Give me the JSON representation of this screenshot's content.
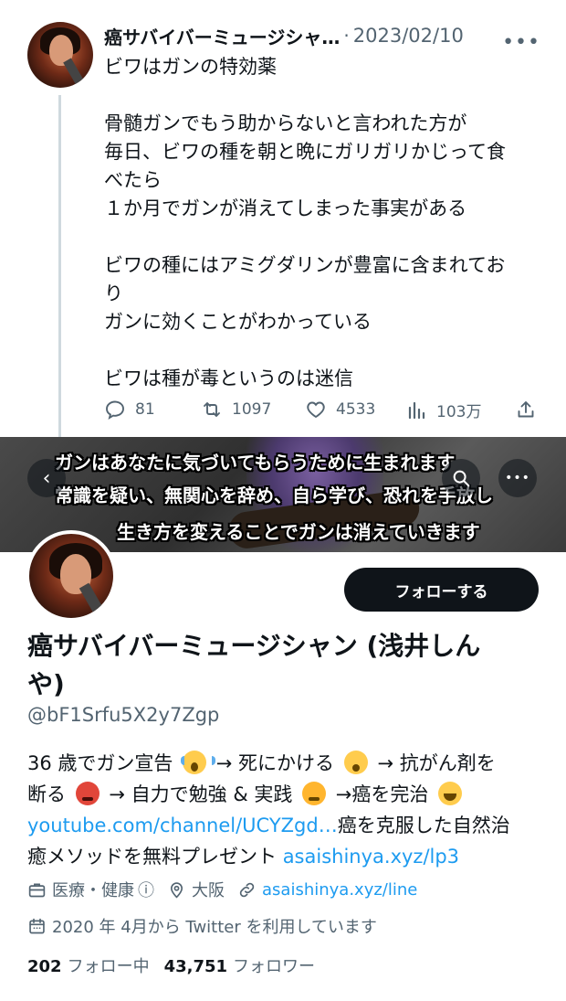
{
  "tweet": {
    "author_name": "癌サバイバーミュージシャ…",
    "separator": "·",
    "date": "2023/02/10",
    "more": "•••",
    "paragraphs": [
      [
        "ビワはガンの特効薬"
      ],
      [
        "骨髄ガンでもう助からないと言われた方が",
        "毎日、ビワの種を朝と晩にガリガリかじって食",
        "べたら",
        "１か月でガンが消えてしまった事実がある"
      ],
      [
        "ビワの種にはアミグダリンが豊富に含まれてお",
        "り",
        "ガンに効くことがわかっている"
      ],
      [
        "ビワは種が毒というのは迷信"
      ]
    ],
    "actions": {
      "replies": "81",
      "retweets": "1097",
      "likes": "4533",
      "views": "103万"
    }
  },
  "banner": {
    "line1": "ガンはあなたに気づいてもらうために生まれます",
    "line2": "常識を疑い、無関心を辞め、自ら学び、恐れを手放し",
    "line3": "生き方を変えることでガンは消えていきます",
    "back_icon": "‹",
    "menu_icon": "•••"
  },
  "profile": {
    "follow_label": "フォローする",
    "name": "癌サバイバーミュージシャン (浅井しんや)",
    "handle": "@bF1Srfu5X2y7Zgp",
    "bio": {
      "l1_a": "36 歳でガン宣告",
      "l1_b": "→ 死にかける",
      "l1_c": "→ 抗がん剤を",
      "l2_a": "断る",
      "l2_b": "→ 自力で勉強 & 実践",
      "l2_c": "→癌を完治",
      "l3_link": "youtube.com/channel/UCYZgd…",
      "l3_text": "癌を克服した自然治",
      "l4_text": "癒メソッドを無料プレゼント",
      "l4_link": "asaishinya.xyz/lp3"
    },
    "category": "医療・健康",
    "info_icon": "ⓘ",
    "location": "大阪",
    "website": "asaishinya.xyz/line",
    "joined": "2020 年 4月から Twitter を利用しています",
    "following_count": "202",
    "following_label": "フォロー中",
    "followers_count": "43,751",
    "followers_label": "フォロワー"
  },
  "colors": {
    "text": "#0f1419",
    "secondary": "#536471",
    "link": "#1d9bf0",
    "button": "#0f1419"
  }
}
